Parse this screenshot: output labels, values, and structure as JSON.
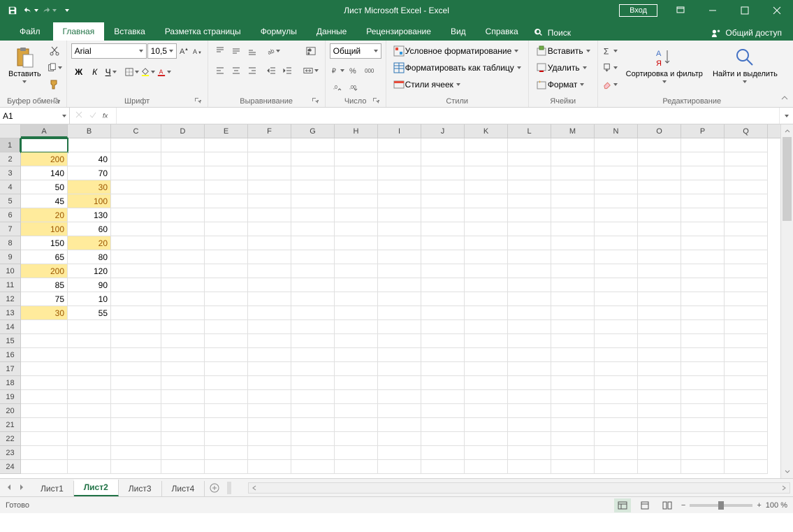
{
  "title": "Лист Microsoft Excel  -  Excel",
  "signin": "Вход",
  "tabs": {
    "file": "Файл",
    "home": "Главная",
    "insert": "Вставка",
    "layout": "Разметка страницы",
    "formulas": "Формулы",
    "data": "Данные",
    "review": "Рецензирование",
    "view": "Вид",
    "help": "Справка",
    "tellme": "Поиск",
    "share": "Общий доступ"
  },
  "ribbon": {
    "clipboard": {
      "paste": "Вставить",
      "label": "Буфер обмена"
    },
    "font": {
      "name": "Arial",
      "size": "10,5",
      "bold": "Ж",
      "italic": "К",
      "underline": "Ч",
      "label": "Шрифт"
    },
    "alignment": {
      "label": "Выравнивание"
    },
    "number": {
      "format": "Общий",
      "label": "Число"
    },
    "styles": {
      "cond": "Условное форматирование",
      "table": "Форматировать как таблицу",
      "cell": "Стили ячеек",
      "label": "Стили"
    },
    "cells": {
      "insert": "Вставить",
      "delete": "Удалить",
      "format": "Формат",
      "label": "Ячейки"
    },
    "editing": {
      "sort": "Сортировка и фильтр",
      "find": "Найти и выделить",
      "label": "Редактирование"
    }
  },
  "namebox": "A1",
  "columns": [
    "A",
    "B",
    "C",
    "D",
    "E",
    "F",
    "G",
    "H",
    "I",
    "J",
    "K",
    "L",
    "M",
    "N",
    "O",
    "P",
    "Q"
  ],
  "rows": 24,
  "cells": {
    "A2": {
      "v": "200",
      "hl": true
    },
    "B2": {
      "v": "40"
    },
    "A3": {
      "v": "140"
    },
    "B3": {
      "v": "70"
    },
    "A4": {
      "v": "50"
    },
    "B4": {
      "v": "30",
      "hl": true
    },
    "A5": {
      "v": "45"
    },
    "B5": {
      "v": "100",
      "hl": true
    },
    "A6": {
      "v": "20",
      "hl": true
    },
    "B6": {
      "v": "130"
    },
    "A7": {
      "v": "100",
      "hl": true
    },
    "B7": {
      "v": "60"
    },
    "A8": {
      "v": "150"
    },
    "B8": {
      "v": "20",
      "hl": true
    },
    "A9": {
      "v": "65"
    },
    "B9": {
      "v": "80"
    },
    "A10": {
      "v": "200",
      "hl": true
    },
    "B10": {
      "v": "120"
    },
    "A11": {
      "v": "85"
    },
    "B11": {
      "v": "90"
    },
    "A12": {
      "v": "75"
    },
    "B12": {
      "v": "10"
    },
    "A13": {
      "v": "30",
      "hl": true
    },
    "B13": {
      "v": "55"
    }
  },
  "active_cell": "A1",
  "sheets": [
    "Лист1",
    "Лист2",
    "Лист3",
    "Лист4"
  ],
  "active_sheet": 1,
  "status": "Готово",
  "zoom": "100 %"
}
